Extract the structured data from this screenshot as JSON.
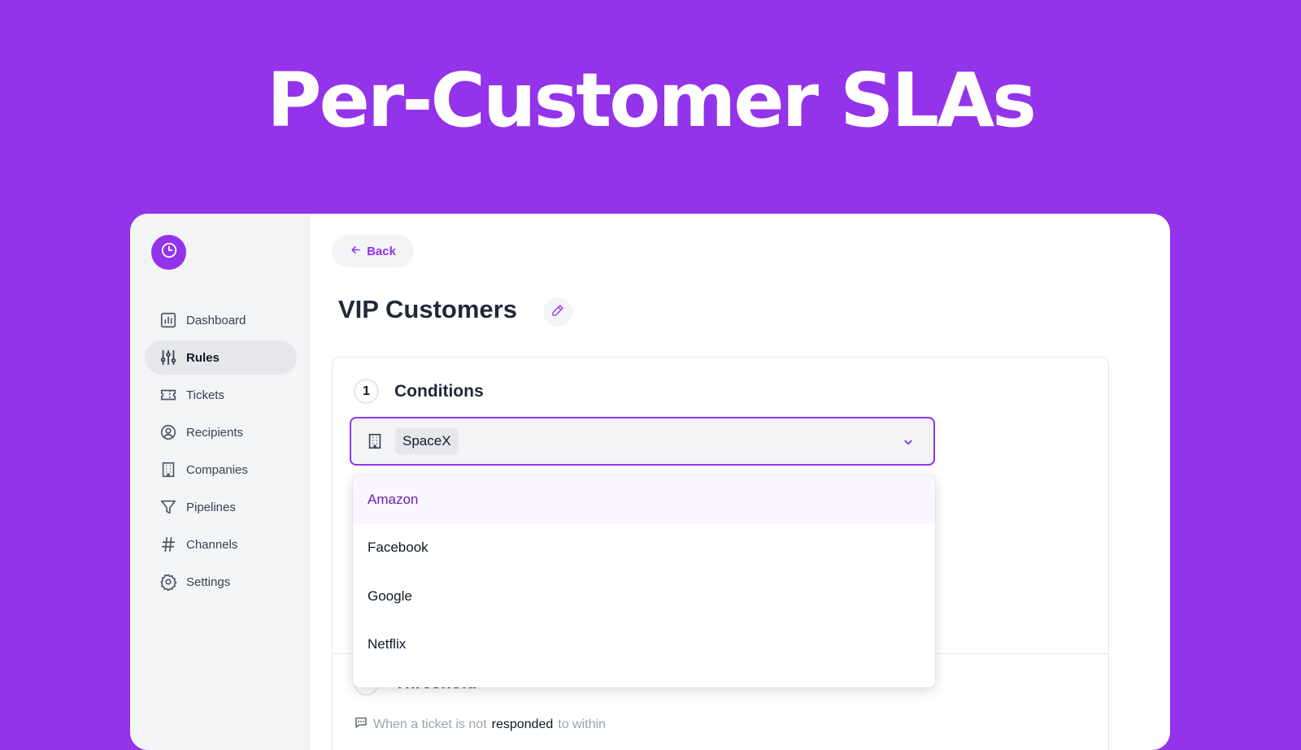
{
  "hero": {
    "title": "Per-Customer SLAs"
  },
  "sidebar": {
    "logo": "clock-icon",
    "items": [
      {
        "label": "Dashboard",
        "icon": "chart-icon"
      },
      {
        "label": "Rules",
        "icon": "sliders-icon",
        "active": true
      },
      {
        "label": "Tickets",
        "icon": "ticket-icon"
      },
      {
        "label": "Recipients",
        "icon": "user-circle-icon"
      },
      {
        "label": "Companies",
        "icon": "building-icon"
      },
      {
        "label": "Pipelines",
        "icon": "funnel-icon"
      },
      {
        "label": "Channels",
        "icon": "hash-icon"
      },
      {
        "label": "Settings",
        "icon": "gear-icon"
      }
    ]
  },
  "main": {
    "back_label": "Back",
    "page_title": "VIP Customers",
    "conditions": {
      "step": "1",
      "title": "Conditions",
      "selected_company": "SpaceX",
      "options": [
        "Amazon",
        "Facebook",
        "Google",
        "Netflix"
      ]
    },
    "threshold": {
      "step": "2",
      "title": "Threshold",
      "desc_prefix": "When a ticket is not",
      "desc_strong": "responded",
      "desc_suffix": "to within"
    }
  },
  "colors": {
    "accent": "#9333ea",
    "sidebar_bg": "#f3f4f6",
    "background": "#9333ea"
  }
}
